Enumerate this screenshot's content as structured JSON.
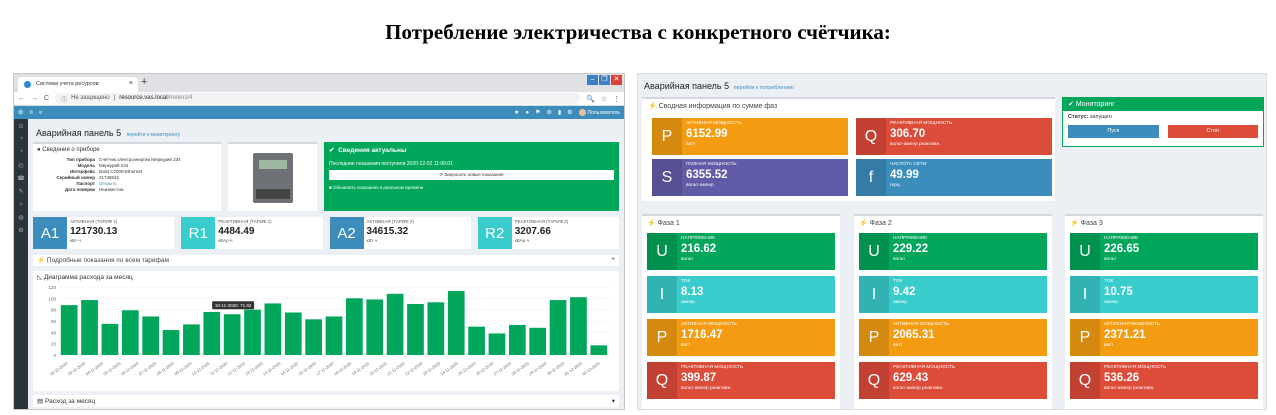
{
  "heading": "Потребление электричества с конкретного счётчика:",
  "browser": {
    "tab_title": "Система учета ресурсов",
    "tab_close": "×",
    "new_tab": "+",
    "win_buttons": [
      "–",
      "❐",
      "✕"
    ],
    "nav_icons": [
      "←",
      "→",
      "C"
    ],
    "security": "Не защищено",
    "url_host": "resource.vas.local",
    "url_path": "/meters/4",
    "addr_icons": [
      "🔍",
      "☆",
      "⋮"
    ]
  },
  "app": {
    "topbar_icons": [
      "★",
      "●",
      "⚑",
      "⚙",
      "▮",
      "⚙"
    ],
    "user_label": "Пользователь",
    "sidebar_icons": [
      "⊙",
      "◔",
      "◔",
      "◴",
      "☎",
      "✎",
      "▿",
      "◍",
      "⚙"
    ],
    "page_title": "Аварийная панель 5",
    "page_link": "перейти к мониторингу",
    "device": {
      "header": "Сведения о приборе",
      "rows": [
        {
          "k": "Тип прибора",
          "v": "Счётчик электроэнергии Меркурий 234"
        },
        {
          "k": "Модель",
          "v": "Меркурий 234"
        },
        {
          "k": "Интерфейс",
          "v": "Bolid C2000-Ethernet"
        },
        {
          "k": "Серийный номер",
          "v": "21748622"
        },
        {
          "k": "Паспорт",
          "v": "Открыть"
        },
        {
          "k": "Дата поверки",
          "v": "Неизвестна"
        }
      ]
    },
    "status": {
      "header": "Сведения актуальны",
      "last_reading": "Последние показания поступили 2020-12-02 11:00:01",
      "request_button": "Запросить новые показания",
      "realtime": "Обновлять показания в реальном времени"
    },
    "tariffs": [
      {
        "icon": "A1",
        "label": "АКТИВНАЯ (ТАРИФ 1)",
        "value": "121730.13",
        "unit": "кВт·ч",
        "color": "#3c8dbc"
      },
      {
        "icon": "R1",
        "label": "РЕАКТИВНАЯ (ТАРИФ 1)",
        "value": "4484.49",
        "unit": "кВАр·ч",
        "color": "#39cccc"
      },
      {
        "icon": "A2",
        "label": "АКТИВНАЯ (ТАРИФ 2)",
        "value": "34615.32",
        "unit": "кВт·ч",
        "color": "#3c8dbc"
      },
      {
        "icon": "R2",
        "label": "РЕАКТИВНАЯ (ТАРИФ 2)",
        "value": "3207.66",
        "unit": "кВАр·ч",
        "color": "#39cccc"
      }
    ],
    "details_header": "Подробные показания по всем тарифам",
    "details_toggle": "+",
    "chart_header": "Диаграмма расхода за месяц",
    "month_header": "Расход за месяц",
    "month_toggle": "▾"
  },
  "chart_data": {
    "type": "bar",
    "title": "Диаграмма расхода за месяц",
    "color": "#00a65a",
    "ylim": [
      0,
      120
    ],
    "yticks": [
      0,
      20,
      40,
      60,
      80,
      100,
      120
    ],
    "categories": [
      "02-11-2020",
      "03-11-2020",
      "04-11-2020",
      "05-11-2020",
      "06-11-2020",
      "07-11-2020",
      "08-11-2020",
      "09-11-2020",
      "10-11-2020",
      "11-11-2020",
      "12-11-2020",
      "13-11-2020",
      "14-11-2020",
      "15-11-2020",
      "16-11-2020",
      "17-11-2020",
      "18-11-2020",
      "19-11-2020",
      "20-11-2020",
      "21-11-2020",
      "22-11-2020",
      "23-11-2020",
      "24-11-2020",
      "25-11-2020",
      "26-11-2020",
      "27-11-2020",
      "28-11-2020",
      "29-11-2020",
      "30-11-2020",
      "01-12-2020",
      "02-12-2020"
    ],
    "values": [
      88,
      97,
      55,
      79,
      68,
      44,
      54,
      76,
      71.92,
      80,
      91,
      75,
      63,
      68,
      100,
      98,
      108,
      90,
      93,
      113,
      50,
      38,
      53,
      48,
      97,
      102,
      17
    ],
    "tooltip": "10-11-2020: 71.92"
  },
  "right": {
    "title": "Аварийная панель 5",
    "title_link": "перейти к потреблению",
    "summary_header": "Сводная информация по сумме фаз",
    "summary": [
      {
        "icon": "P",
        "label": "АКТИВНАЯ МОЩНОСТЬ",
        "value": "6152.99",
        "unit": "ватт",
        "color": "#f39c12"
      },
      {
        "icon": "Q",
        "label": "РЕАКТИВНАЯ МОЩНОСТЬ",
        "value": "306.70",
        "unit": "вольт-ампер реактивн.",
        "color": "#dd4b39"
      },
      {
        "icon": "S",
        "label": "ПОЛНАЯ МОЩНОСТЬ",
        "value": "6355.52",
        "unit": "вольт-ампер",
        "color": "#605ca8"
      },
      {
        "icon": "f",
        "label": "ЧАСТОТА СЕТИ",
        "value": "49.99",
        "unit": "герц",
        "color": "#3c8dbc"
      }
    ],
    "monitoring": {
      "header": "Мониторинг",
      "status_label": "Статус:",
      "status_value": "запущен",
      "start": "Пуск",
      "stop": "Стоп"
    },
    "phases": [
      {
        "name": "Фаза 1",
        "items": [
          {
            "icon": "U",
            "label": "НАПРЯЖЕНИЕ",
            "value": "216.62",
            "unit": "вольт"
          },
          {
            "icon": "I",
            "label": "ТОК",
            "value": "8.13",
            "unit": "ампер"
          },
          {
            "icon": "P",
            "label": "АКТИВНАЯ МОЩНОСТЬ",
            "value": "1716.47",
            "unit": "ватт"
          },
          {
            "icon": "Q",
            "label": "РЕАКТИВНАЯ МОЩНОСТЬ",
            "value": "399.87",
            "unit": "вольт-ампер реактивн."
          }
        ]
      },
      {
        "name": "Фаза 2",
        "items": [
          {
            "icon": "U",
            "label": "НАПРЯЖЕНИЕ",
            "value": "229.22",
            "unit": "вольт"
          },
          {
            "icon": "I",
            "label": "ТОК",
            "value": "9.42",
            "unit": "ампер"
          },
          {
            "icon": "P",
            "label": "АКТИВНАЯ МОЩНОСТЬ",
            "value": "2065.31",
            "unit": "ватт"
          },
          {
            "icon": "Q",
            "label": "РЕАКТИВНАЯ МОЩНОСТЬ",
            "value": "629.43",
            "unit": "вольт-ампер реактивн."
          }
        ]
      },
      {
        "name": "Фаза 3",
        "items": [
          {
            "icon": "U",
            "label": "НАПРЯЖЕНИЕ",
            "value": "226.65",
            "unit": "вольт"
          },
          {
            "icon": "I",
            "label": "ТОК",
            "value": "10.75",
            "unit": "ампер"
          },
          {
            "icon": "P",
            "label": "АКТИВНАЯ МОЩНОСТЬ",
            "value": "2371.21",
            "unit": "ватт"
          },
          {
            "icon": "Q",
            "label": "РЕАКТИВНАЯ МОЩНОСТЬ",
            "value": "536.26",
            "unit": "вольт-ампер реактивн."
          }
        ]
      }
    ],
    "phase_colors": [
      "#00a65a",
      "#39cccc",
      "#f39c12",
      "#dd4b39"
    ]
  }
}
